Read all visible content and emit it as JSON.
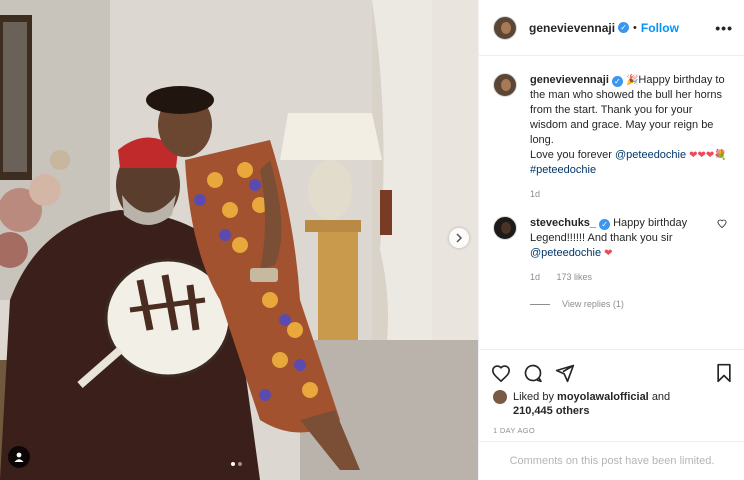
{
  "post": {
    "username": "genevievennaji",
    "follow_label": "Follow",
    "separator": "•",
    "more_label": "•••",
    "caption": {
      "username": "genevievennaji",
      "emoji_start": "🎉",
      "text": "Happy birthday to the man who showed the bull her horns from the start. Thank you for your wisdom and grace. May your reign be long.",
      "text2": "Love you forever",
      "mention": "@peteedochie",
      "emoji_end": "❤❤❤💐",
      "hashtag": "#peteedochie",
      "age": "1d"
    },
    "comments": [
      {
        "username": "stevechuks_",
        "text": "Happy birthday Legend!!!!!! And thank you sir",
        "mention": "@peteedochie",
        "emoji": "❤",
        "age": "1d",
        "likes": "173 likes",
        "replies": "View replies (1)"
      }
    ],
    "liked_by_prefix": "Liked by",
    "liked_by_user": "moyolawalofficial",
    "liked_by_suffix": "and",
    "liked_count": "210,445 others",
    "time_ago": "1 DAY AGO",
    "comments_limited": "Comments on this post have been limited.",
    "carousel": {
      "current": 1,
      "total": 2
    },
    "colors": {
      "accent": "#0095f6",
      "mention": "#00376b",
      "like_red": "#ed4956",
      "muted": "#8e8e8e"
    }
  }
}
